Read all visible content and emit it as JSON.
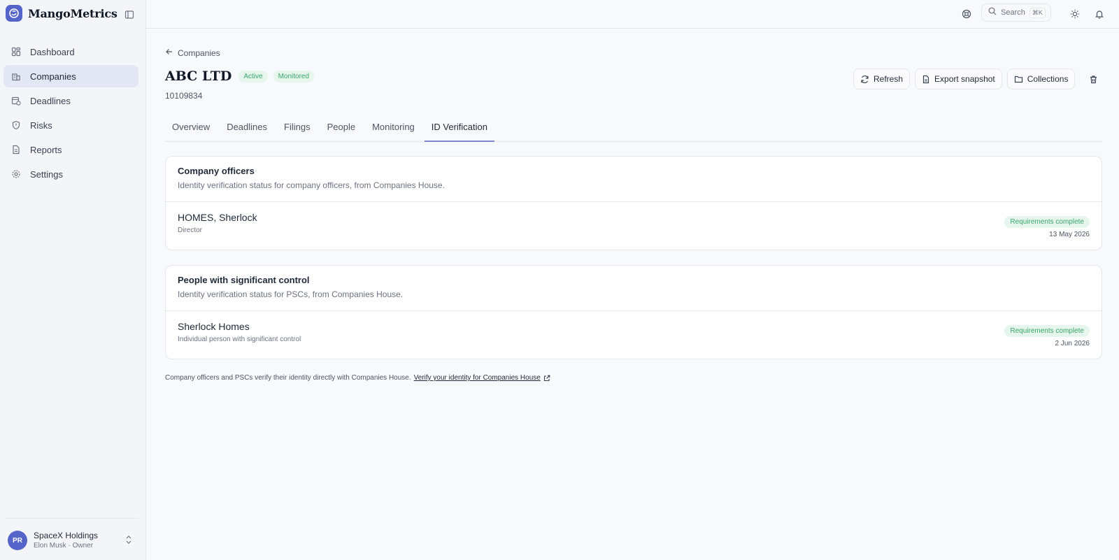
{
  "app": {
    "name": "MangoMetrics"
  },
  "sidebar": {
    "items": [
      {
        "label": "Dashboard",
        "icon": "dashboard-icon"
      },
      {
        "label": "Companies",
        "icon": "building-icon",
        "active": true
      },
      {
        "label": "Deadlines",
        "icon": "calendar-clock-icon"
      },
      {
        "label": "Risks",
        "icon": "shield-icon"
      },
      {
        "label": "Reports",
        "icon": "file-text-icon"
      },
      {
        "label": "Settings",
        "icon": "gear-icon"
      }
    ]
  },
  "user": {
    "initials": "PR",
    "org": "SpaceX Holdings",
    "subtitle": "Elon Musk · Owner"
  },
  "topbar": {
    "search_label": "Search",
    "search_shortcut": "⌘K"
  },
  "page": {
    "back_label": "Companies",
    "title": "ABC LTD",
    "badges": [
      "Active",
      "Monitored"
    ],
    "company_number": "10109834",
    "actions": {
      "refresh": "Refresh",
      "export": "Export snapshot",
      "collections": "Collections"
    }
  },
  "tabs": [
    "Overview",
    "Deadlines",
    "Filings",
    "People",
    "Monitoring",
    "ID Verification"
  ],
  "active_tab": "ID Verification",
  "officers": {
    "title": "Company officers",
    "description": "Identity verification status for company officers, from Companies House.",
    "rows": [
      {
        "name": "HOMES, Sherlock",
        "role": "Director",
        "status": "Requirements complete",
        "date": "13 May 2026"
      }
    ]
  },
  "pscs": {
    "title": "People with significant control",
    "description": "Identity verification status for PSCs, from Companies House.",
    "rows": [
      {
        "name": "Sherlock Homes",
        "role": "Individual person with significant control",
        "status": "Requirements complete",
        "date": "2 Jun 2026"
      }
    ]
  },
  "footer": {
    "text": "Company officers and PSCs verify their identity directly with Companies House.",
    "link": "Verify your identity for Companies House"
  },
  "colors": {
    "accent": "#5564c9",
    "success_text": "#3aa56c",
    "success_bg": "#e6f6ec"
  }
}
